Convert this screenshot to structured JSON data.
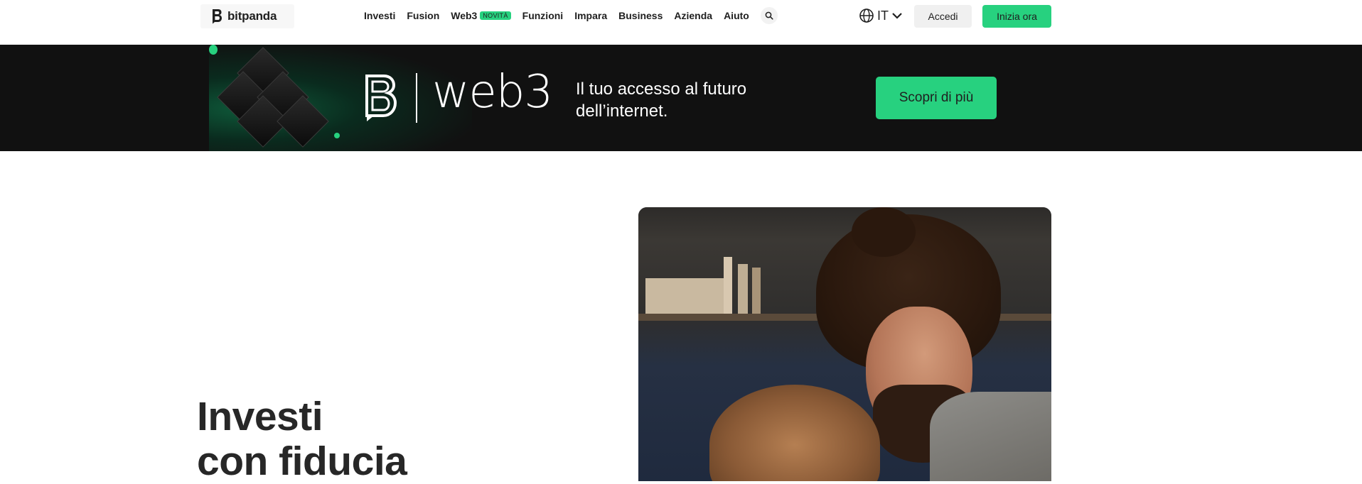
{
  "header": {
    "logo_text": "bitpanda",
    "nav": [
      {
        "label": "Investi"
      },
      {
        "label": "Fusion"
      },
      {
        "label": "Web3",
        "badge": "NOVITÀ"
      },
      {
        "label": "Funzioni"
      },
      {
        "label": "Impara"
      },
      {
        "label": "Business"
      },
      {
        "label": "Azienda"
      },
      {
        "label": "Aiuto"
      }
    ],
    "language": "IT",
    "login_label": "Accedi",
    "start_label": "Inizia ora"
  },
  "banner": {
    "brand_word": "web3",
    "text_line1": "Il tuo accesso al futuro",
    "text_line2": "dell’internet.",
    "cta_label": "Scopri di più"
  },
  "hero": {
    "title_line1": "Investi",
    "title_line2": "con fiducia"
  },
  "colors": {
    "accent": "#27d17f",
    "banner_bg": "#111111",
    "text": "#1f1f1f"
  },
  "icons": [
    "bitpanda-logo-icon",
    "search-icon",
    "globe-icon",
    "chevron-down-icon",
    "web3-logo-icon"
  ]
}
